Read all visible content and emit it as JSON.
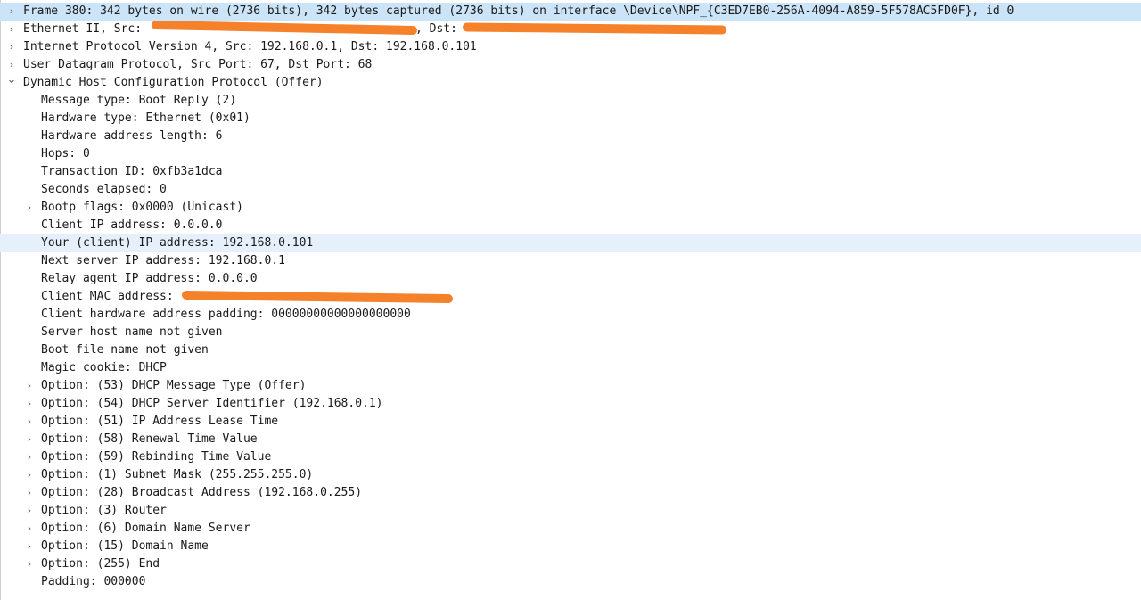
{
  "tree": [
    {
      "text": "Frame 380: 342 bytes on wire (2736 bits), 342 bytes captured (2736 bits) on interface \\Device\\NPF_{C3ED7EB0-256A-4094-A859-5F578AC5FD0F}, id 0",
      "level": 0,
      "toggle": "collapsed",
      "state": "selected"
    },
    {
      "text": "Ethernet II, Src: ",
      "text_after": ", Dst: ",
      "level": 0,
      "toggle": "collapsed",
      "redacted": true
    },
    {
      "text": "Internet Protocol Version 4, Src: 192.168.0.1, Dst: 192.168.0.101",
      "level": 0,
      "toggle": "collapsed"
    },
    {
      "text": "User Datagram Protocol, Src Port: 67, Dst Port: 68",
      "level": 0,
      "toggle": "collapsed"
    },
    {
      "text": "Dynamic Host Configuration Protocol (Offer)",
      "level": 0,
      "toggle": "expanded"
    },
    {
      "text": "Message type: Boot Reply (2)",
      "level": 1,
      "toggle": "none"
    },
    {
      "text": "Hardware type: Ethernet (0x01)",
      "level": 1,
      "toggle": "none"
    },
    {
      "text": "Hardware address length: 6",
      "level": 1,
      "toggle": "none"
    },
    {
      "text": "Hops: 0",
      "level": 1,
      "toggle": "none"
    },
    {
      "text": "Transaction ID: 0xfb3a1dca",
      "level": 1,
      "toggle": "none"
    },
    {
      "text": "Seconds elapsed: 0",
      "level": 1,
      "toggle": "none"
    },
    {
      "text": "Bootp flags: 0x0000 (Unicast)",
      "level": 1,
      "toggle": "collapsed"
    },
    {
      "text": "Client IP address: 0.0.0.0",
      "level": 1,
      "toggle": "none"
    },
    {
      "text": "Your (client) IP address: 192.168.0.101",
      "level": 1,
      "toggle": "none",
      "state": "hover"
    },
    {
      "text": "Next server IP address: 192.168.0.1",
      "level": 1,
      "toggle": "none"
    },
    {
      "text": "Relay agent IP address: 0.0.0.0",
      "level": 1,
      "toggle": "none"
    },
    {
      "text": "Client MAC address: ",
      "level": 1,
      "toggle": "none",
      "redacted": true
    },
    {
      "text": "Client hardware address padding: 00000000000000000000",
      "level": 1,
      "toggle": "none"
    },
    {
      "text": "Server host name not given",
      "level": 1,
      "toggle": "none"
    },
    {
      "text": "Boot file name not given",
      "level": 1,
      "toggle": "none"
    },
    {
      "text": "Magic cookie: DHCP",
      "level": 1,
      "toggle": "none"
    },
    {
      "text": "Option: (53) DHCP Message Type (Offer)",
      "level": 1,
      "toggle": "collapsed"
    },
    {
      "text": "Option: (54) DHCP Server Identifier (192.168.0.1)",
      "level": 1,
      "toggle": "collapsed"
    },
    {
      "text": "Option: (51) IP Address Lease Time",
      "level": 1,
      "toggle": "collapsed"
    },
    {
      "text": "Option: (58) Renewal Time Value",
      "level": 1,
      "toggle": "collapsed"
    },
    {
      "text": "Option: (59) Rebinding Time Value",
      "level": 1,
      "toggle": "collapsed"
    },
    {
      "text": "Option: (1) Subnet Mask (255.255.255.0)",
      "level": 1,
      "toggle": "collapsed"
    },
    {
      "text": "Option: (28) Broadcast Address (192.168.0.255)",
      "level": 1,
      "toggle": "collapsed"
    },
    {
      "text": "Option: (3) Router",
      "level": 1,
      "toggle": "collapsed"
    },
    {
      "text": "Option: (6) Domain Name Server",
      "level": 1,
      "toggle": "collapsed"
    },
    {
      "text": "Option: (15) Domain Name",
      "level": 1,
      "toggle": "collapsed"
    },
    {
      "text": "Option: (255) End",
      "level": 1,
      "toggle": "collapsed"
    },
    {
      "text": "Padding: 000000",
      "level": 1,
      "toggle": "none"
    }
  ],
  "icons": {
    "collapsed": "chevron-right-icon",
    "expanded": "chevron-down-icon"
  },
  "colors": {
    "selected_row": "#cce4f7",
    "hover_row": "#e6f0fa",
    "redaction": "#f47a20"
  }
}
